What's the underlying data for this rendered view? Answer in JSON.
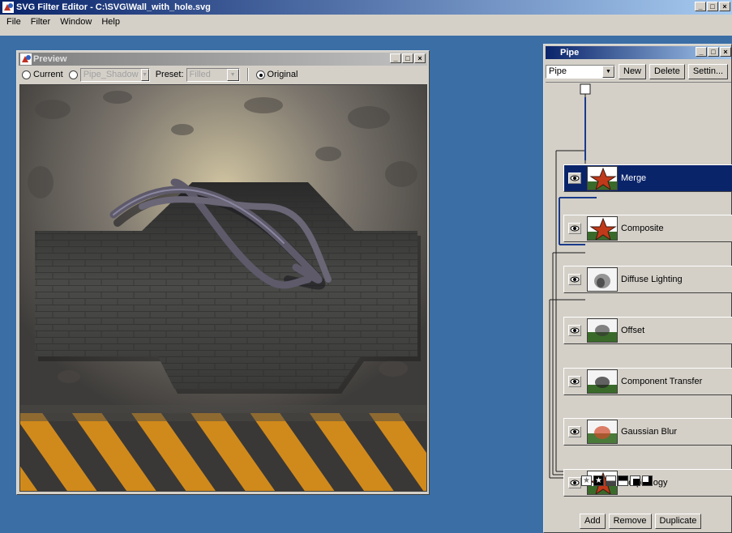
{
  "app": {
    "title": "SVG Filter Editor - C:\\SVG\\Wall_with_hole.svg"
  },
  "menu": [
    "File",
    "Filter",
    "Window",
    "Help"
  ],
  "preview": {
    "title": "Preview",
    "current_label": "Current",
    "filter_select_value": "Pipe_Shadow",
    "preset_label": "Preset:",
    "preset_value": "Filled",
    "original_label": "Original",
    "selected_radio": "original"
  },
  "pipe": {
    "title": "Pipe",
    "filter_select_value": "Pipe",
    "buttons": {
      "new": "New",
      "delete": "Delete",
      "settings": "Settin..."
    },
    "nodes": [
      {
        "label": "Merge",
        "selected": true,
        "thumb": "star-red"
      },
      {
        "label": "Composite",
        "selected": false,
        "thumb": "star-red"
      },
      {
        "label": "Diffuse Lighting",
        "selected": false,
        "thumb": "blur-gray"
      },
      {
        "label": "Offset",
        "selected": false,
        "thumb": "blur-green"
      },
      {
        "label": "Component Transfer",
        "selected": false,
        "thumb": "blur-green"
      },
      {
        "label": "Gaussian Blur",
        "selected": false,
        "thumb": "blur-red"
      },
      {
        "label": "Morphology",
        "selected": false,
        "thumb": "star-red"
      }
    ],
    "bottom_buttons": {
      "add": "Add",
      "remove": "Remove",
      "duplicate": "Duplicate"
    }
  },
  "colors": {
    "desktop": "#3a6ea5",
    "active_title": "#0a246a",
    "selected_node": "#0a246a"
  }
}
